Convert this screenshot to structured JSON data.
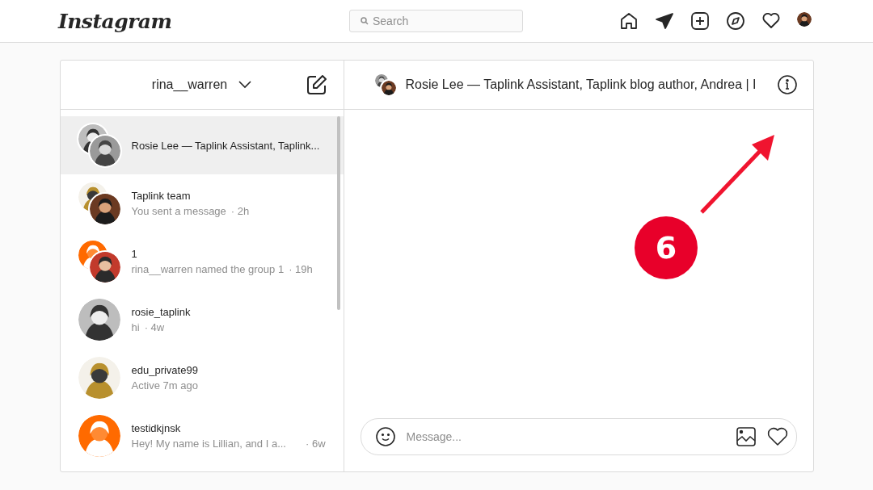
{
  "header": {
    "logo": "Instagram",
    "search": {
      "placeholder": "Search"
    }
  },
  "inbox": {
    "account": "rina__warren",
    "conversations": [
      {
        "name": "Rosie Lee — Taplink Assistant, Taplink...",
        "group": true,
        "selected": true
      },
      {
        "name": "Taplink team",
        "preview": "You sent a message",
        "time": "· 2h",
        "group": true,
        "selected": false
      },
      {
        "name": "1",
        "preview": "rina__warren named the group 1",
        "time": "· 19h",
        "group": true,
        "selected": false
      },
      {
        "name": "rosie_taplink",
        "preview": "hi",
        "time": "· 4w",
        "group": false,
        "selected": false
      },
      {
        "name": "edu_private99",
        "preview": "Active 7m ago",
        "group": false,
        "selected": false
      },
      {
        "name": "testidkjnsk",
        "preview": "Hey! My name is Lillian, and I a...",
        "time": "· 6w",
        "group": false,
        "selected": false
      }
    ]
  },
  "thread": {
    "title": "Rosie Lee — Taplink Assistant, Taplink blog author, Andrea | I",
    "message": {
      "placeholder": "Message..."
    }
  },
  "annotation": {
    "label": "6"
  }
}
